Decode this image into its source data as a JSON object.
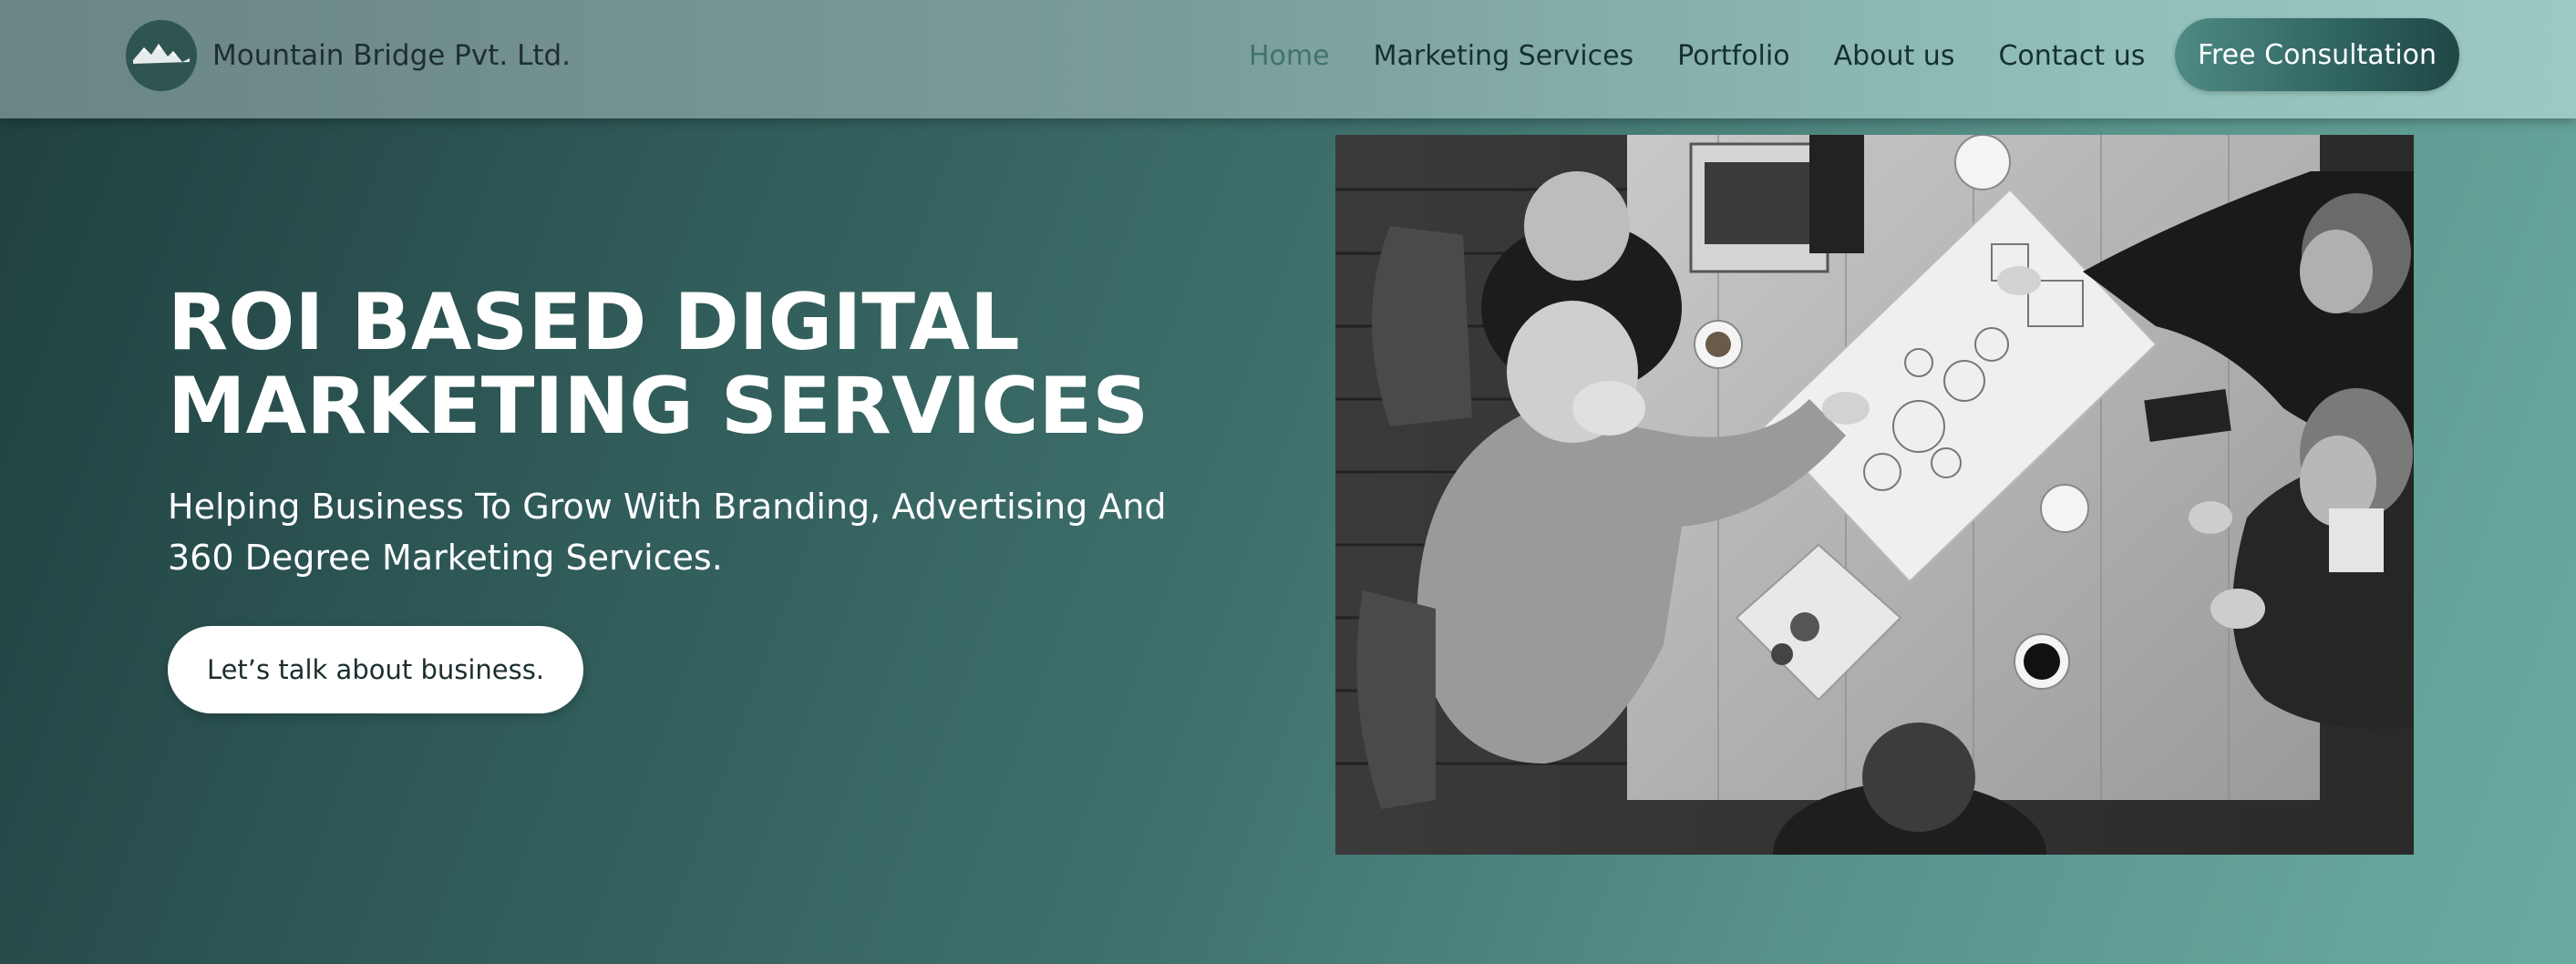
{
  "header": {
    "brand_name": "Mountain Bridge Pvt. Ltd.",
    "logo_icon": "mountain-icon",
    "nav": [
      {
        "label": "Home",
        "active": true
      },
      {
        "label": "Marketing Services",
        "active": false
      },
      {
        "label": "Portfolio",
        "active": false
      },
      {
        "label": "About us",
        "active": false
      },
      {
        "label": "Contact us",
        "active": false
      }
    ],
    "cta_label": "Free Consultation"
  },
  "hero": {
    "title_line1": "ROI BASED DIGITAL",
    "title_line2": "MARKETING SERVICES",
    "subtitle": "Helping Business To Grow With Branding, Advertising And 360 Degree Marketing Services.",
    "button_label": "Let’s talk about business."
  },
  "colors": {
    "accent_dark": "#1f4746",
    "accent": "#3f746f",
    "text_dark": "#16302f",
    "white": "#ffffff"
  }
}
